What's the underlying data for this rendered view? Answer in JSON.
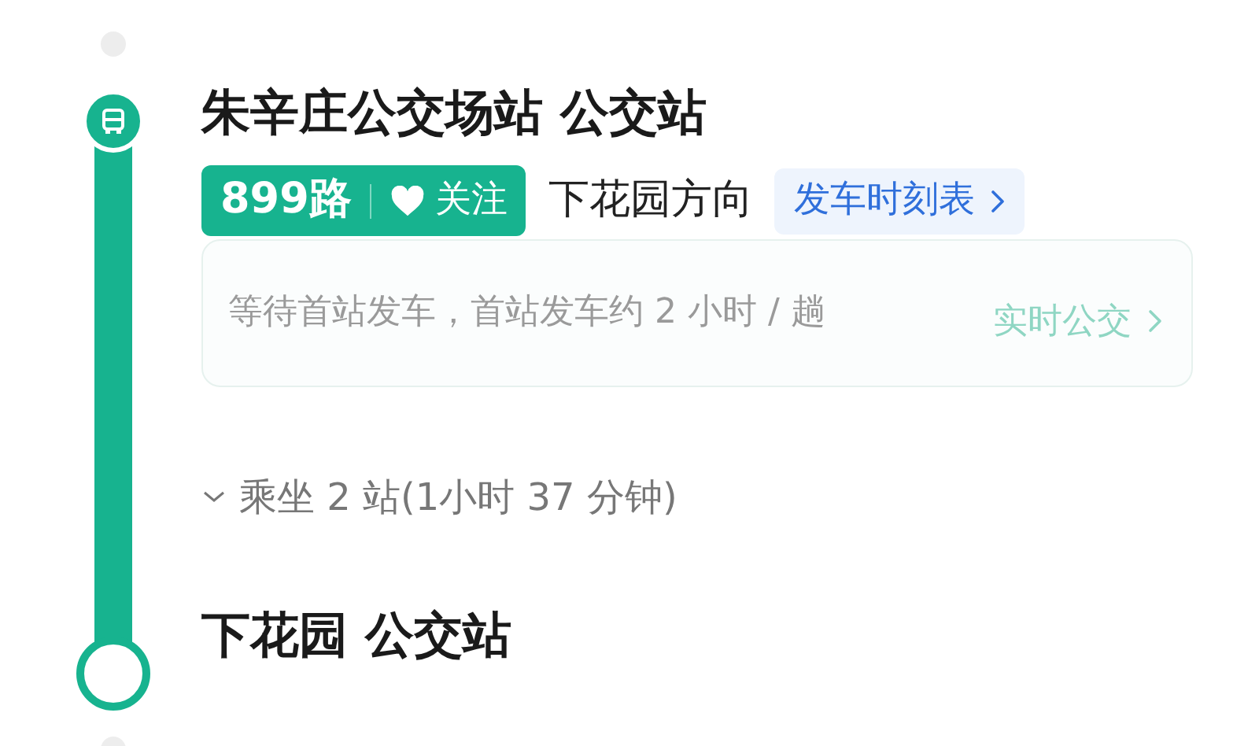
{
  "departure_stop": {
    "name": "朱辛庄公交场站 公交站"
  },
  "route": {
    "line": "899路",
    "follow_label": "关注",
    "direction": "下花园方向",
    "timetable_link": "发车时刻表"
  },
  "realtime_card": {
    "message": "等待首站发车，首站发车约 2 小时 / 趟",
    "link": "实时公交"
  },
  "ride_summary": {
    "text": "乘坐 2 站(1小时 37 分钟)",
    "expanded": false
  },
  "arrival_stop": {
    "name": "下花园 公交站"
  }
}
